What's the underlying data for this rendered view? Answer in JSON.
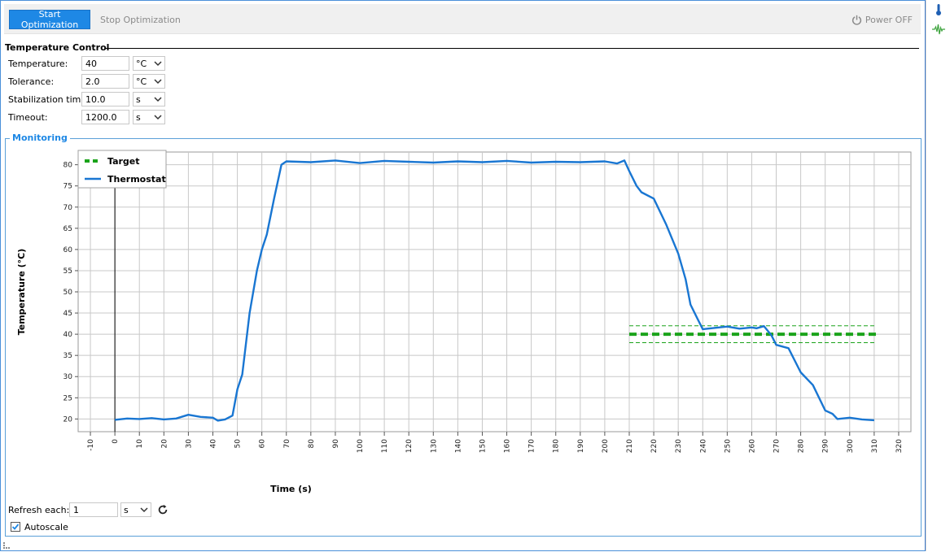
{
  "toolbar": {
    "start_label": "Start Optimization",
    "stop_label": "Stop Optimization",
    "power_label": "Power OFF"
  },
  "temperature_control": {
    "title": "Temperature Control",
    "rows": [
      {
        "label": "Temperature:",
        "value": "40",
        "unit": "°C"
      },
      {
        "label": "Tolerance:",
        "value": "2.0",
        "unit": "°C"
      },
      {
        "label": "Stabilization time:",
        "value": "10.0",
        "unit": "s"
      },
      {
        "label": "Timeout:",
        "value": "1200.0",
        "unit": "s"
      }
    ]
  },
  "monitoring": {
    "title": "Monitoring",
    "refresh_label": "Refresh each:",
    "refresh_value": "1",
    "refresh_unit": "s",
    "autoscale_label": "Autoscale",
    "autoscale_checked": true
  },
  "colors": {
    "accent": "#1e88e5",
    "thermostat": "#1976d2",
    "target": "#1aa31a",
    "grid": "#c8c8c8"
  },
  "chart_data": {
    "type": "line",
    "xlabel": "Time (s)",
    "ylabel": "Temperature (°C)",
    "xlim": [
      -15,
      325
    ],
    "ylim": [
      17,
      83
    ],
    "xticks": [
      -10,
      0,
      10,
      20,
      30,
      40,
      50,
      60,
      70,
      80,
      90,
      100,
      110,
      120,
      130,
      140,
      150,
      160,
      170,
      180,
      190,
      200,
      210,
      220,
      230,
      240,
      250,
      260,
      270,
      280,
      290,
      300,
      310,
      320
    ],
    "yticks": [
      20,
      25,
      30,
      35,
      40,
      45,
      50,
      55,
      60,
      65,
      70,
      75,
      80
    ],
    "grid": true,
    "legend_position": "top-left",
    "series": [
      {
        "name": "Target",
        "style": "dashed",
        "x": [
          210,
          311
        ],
        "y": [
          40,
          40
        ],
        "band": [
          38,
          42
        ]
      },
      {
        "name": "Thermostat",
        "style": "solid",
        "x": [
          0,
          5,
          10,
          15,
          20,
          25,
          30,
          35,
          40,
          42,
          45,
          48,
          50,
          52,
          55,
          58,
          60,
          62,
          65,
          68,
          70,
          80,
          90,
          100,
          110,
          120,
          130,
          140,
          150,
          160,
          170,
          180,
          190,
          200,
          205,
          208,
          210,
          213,
          215,
          220,
          225,
          230,
          233,
          235,
          238,
          240,
          245,
          250,
          255,
          260,
          262,
          265,
          268,
          270,
          275,
          280,
          285,
          290,
          293,
          295,
          300,
          305,
          310
        ],
        "y": [
          19.8,
          20.1,
          20.0,
          20.2,
          19.9,
          20.1,
          21.0,
          20.5,
          20.3,
          19.6,
          19.9,
          20.8,
          27.0,
          30.5,
          45.0,
          55.0,
          60.0,
          63.5,
          72.0,
          80.0,
          80.8,
          80.6,
          81.0,
          80.4,
          80.9,
          80.7,
          80.5,
          80.8,
          80.6,
          80.9,
          80.5,
          80.7,
          80.6,
          80.8,
          80.3,
          81.0,
          78.5,
          75.0,
          73.5,
          72.0,
          66.0,
          59.0,
          53.0,
          47.0,
          43.5,
          41.2,
          41.5,
          41.8,
          41.3,
          41.6,
          41.4,
          41.9,
          39.8,
          37.5,
          36.7,
          31.0,
          28.0,
          22.0,
          21.2,
          20.0,
          20.3,
          19.9,
          19.7
        ]
      }
    ]
  }
}
